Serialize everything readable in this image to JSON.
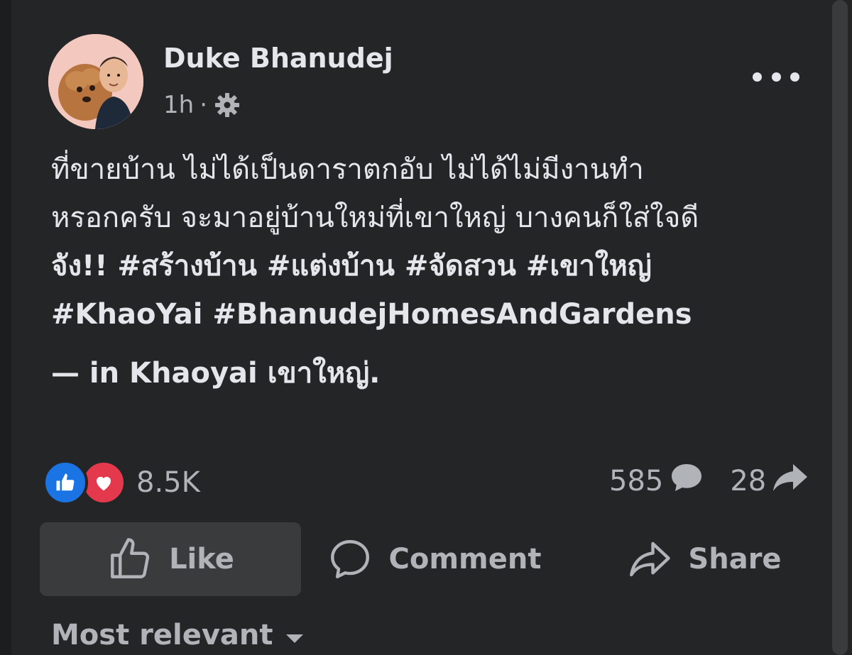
{
  "post": {
    "author": "Duke Bhanudej",
    "time": "1h",
    "separator": "·",
    "privacy_icon": "gear-icon",
    "more_icon": "more-options-icon",
    "body_lines": [
      "ที่ขายบ้าน ไม่ได้เป็นดาราตกอับ ไม่ได้ไม่มีงานทำ",
      "หรอกครับ จะมาอยู่บ้านใหม่ที่เขาใหญ่ บางคนก็ใส่ใจดี",
      "จัง!! #สร้างบ้าน #แต่งบ้าน #จัดสวน #เขาใหญ่",
      "#KhaoYai #BhanudejHomesAndGardens"
    ],
    "location": "— in Khaoyai เขาใหญ่."
  },
  "reactions": {
    "count": "8.5K",
    "icons": [
      "like-reaction-icon",
      "love-reaction-icon"
    ]
  },
  "engagement": {
    "comments": "585",
    "shares": "28"
  },
  "actions": {
    "like": "Like",
    "comment": "Comment",
    "share": "Share"
  },
  "comments_sort": {
    "label": "Most relevant"
  },
  "colors": {
    "background": "#242526",
    "text": "#e4e6eb",
    "secondary_text": "#b0b3b8",
    "like_blue": "#1b74e4",
    "love_red": "#e4394c",
    "button_hover": "#3a3b3c"
  }
}
